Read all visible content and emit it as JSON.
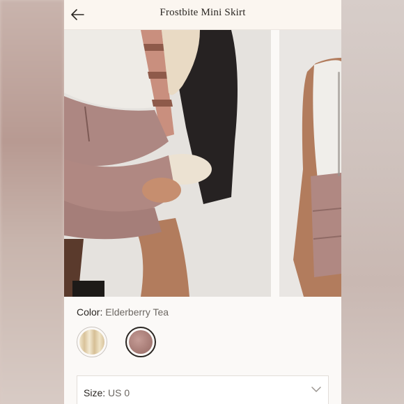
{
  "header": {
    "title": "Frostbite Mini Skirt",
    "back_icon": "arrow-left-icon"
  },
  "color": {
    "label": "Color:",
    "value": "Elderberry Tea",
    "swatches": [
      {
        "name": "cream",
        "color": "#e8d9b8"
      },
      {
        "name": "elderberry-tea",
        "color": "#b08882"
      }
    ],
    "selected": "elderberry-tea"
  },
  "size": {
    "label": "Size:",
    "value": "US 0",
    "icon": "chevron-down-icon"
  },
  "colors": {
    "accent": "#2a2622",
    "muted": "#6c6762",
    "skirt": "#b08882"
  }
}
